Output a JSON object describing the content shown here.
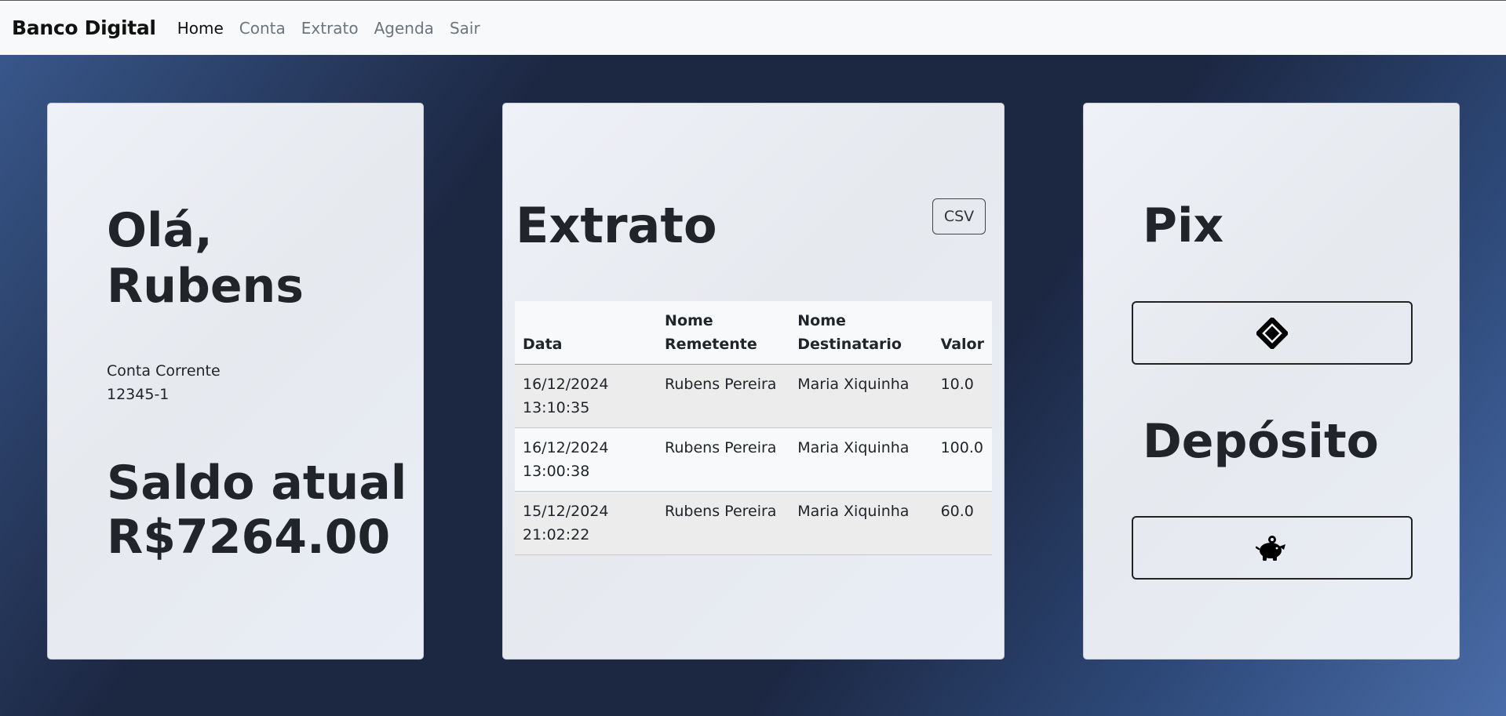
{
  "navbar": {
    "brand": "Banco Digital",
    "links": [
      {
        "label": "Home",
        "active": true
      },
      {
        "label": "Conta",
        "active": false
      },
      {
        "label": "Extrato",
        "active": false
      },
      {
        "label": "Agenda",
        "active": false
      },
      {
        "label": "Sair",
        "active": false
      }
    ]
  },
  "greeting": {
    "text": "Olá, Rubens",
    "account_type": "Conta Corrente",
    "account_number": "12345-1",
    "balance_label": "Saldo atual",
    "balance_value": "R$7264.00"
  },
  "extrato": {
    "title": "Extrato",
    "csv_label": "CSV",
    "columns": [
      "Data",
      "Nome Remetente",
      "Nome Destinatario",
      "Valor"
    ],
    "rows": [
      {
        "date": "16/12/2024",
        "time": "13:10:35",
        "sender": "Rubens Pereira",
        "recipient": "Maria Xiquinha",
        "value": "10.0"
      },
      {
        "date": "16/12/2024",
        "time": "13:00:38",
        "sender": "Rubens Pereira",
        "recipient": "Maria Xiquinha",
        "value": "100.0"
      },
      {
        "date": "15/12/2024",
        "time": "21:02:22",
        "sender": "Rubens Pereira",
        "recipient": "Maria Xiquinha",
        "value": "60.0"
      }
    ]
  },
  "pix": {
    "title": "Pix",
    "button_icon": "pix-icon"
  },
  "deposito": {
    "title": "Depósito",
    "button_icon": "piggy-bank-icon"
  },
  "colors": {
    "navbar_bg": "#f8f9fa",
    "card_bg": "#e9ecf2",
    "page_bg_dark": "#1c2742",
    "page_bg_light": "#4a6ca8",
    "text": "#212529",
    "nav_inactive": "#6c757d"
  }
}
